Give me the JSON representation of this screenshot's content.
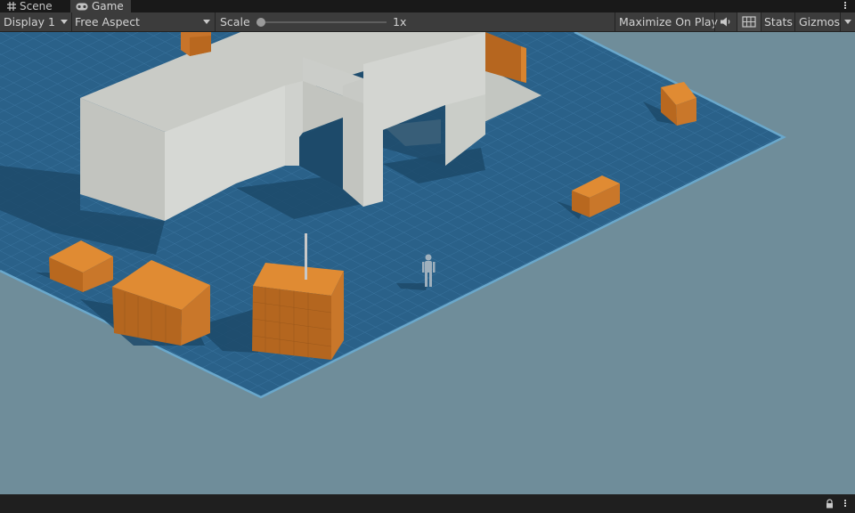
{
  "tabs": [
    {
      "label": "Scene",
      "icon": "grid-icon"
    },
    {
      "label": "Game",
      "icon": "gamepad-icon"
    }
  ],
  "toolbar": {
    "display": "Display 1",
    "aspect": "Free Aspect",
    "scale_label": "Scale",
    "scale_value": "1x",
    "maximize": "Maximize On Play",
    "stats": "Stats",
    "gizmos": "Gizmos"
  },
  "colors": {
    "tab_bar": "#191919",
    "toolbar": "#3c3c3c",
    "viewport_bg": "#6f8d9a",
    "ground": "#2a6189",
    "box": "#d07d27",
    "building": "#c9cbc6"
  }
}
